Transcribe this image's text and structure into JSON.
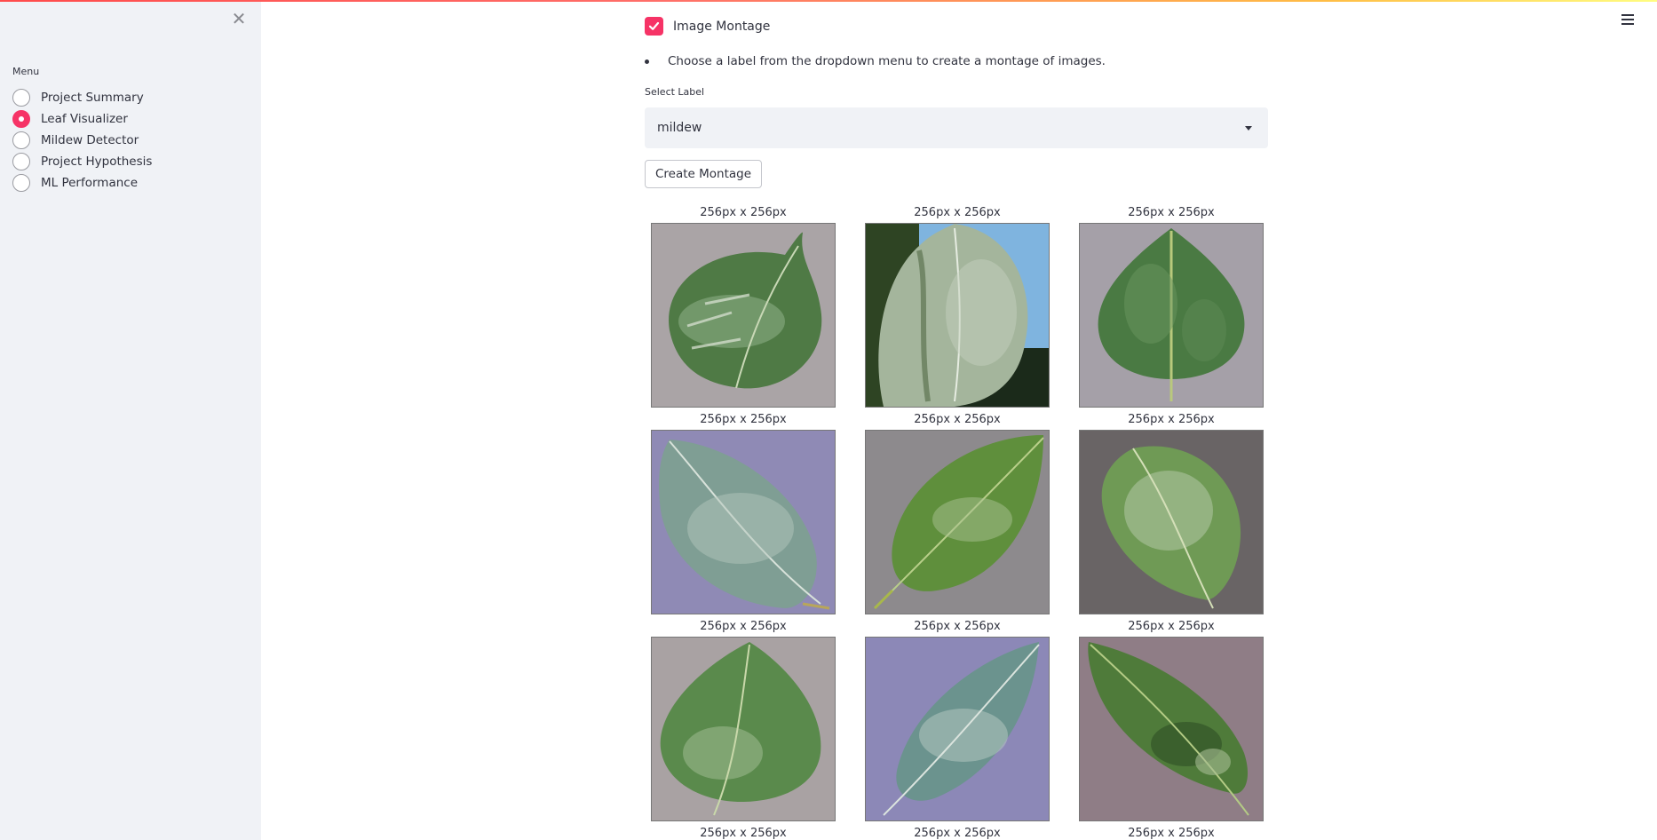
{
  "sidebar": {
    "close_icon": "close-icon",
    "menu_label": "Menu",
    "items": [
      {
        "label": "Project Summary",
        "selected": false
      },
      {
        "label": "Leaf Visualizer",
        "selected": true
      },
      {
        "label": "Mildew Detector",
        "selected": false
      },
      {
        "label": "Project Hypothesis",
        "selected": false
      },
      {
        "label": "ML Performance",
        "selected": false
      }
    ]
  },
  "main": {
    "checkbox_label": "Image Montage",
    "checkbox_checked": true,
    "instruction": "Choose a label from the dropdown menu to create a montage of images.",
    "select_label": "Select Label",
    "select_value": "mildew",
    "button_label": "Create Montage",
    "captions": [
      "256px x 256px",
      "256px x 256px",
      "256px x 256px",
      "256px x 256px",
      "256px x 256px",
      "256px x 256px",
      "256px x 256px",
      "256px x 256px",
      "256px x 256px",
      "256px x 256px",
      "256px x 256px",
      "256px x 256px"
    ]
  },
  "colors": {
    "accent": "#f63366",
    "sidebar_bg": "#f0f2f6",
    "text": "#31333f"
  },
  "icons": {
    "menu": "hamburger-menu-icon",
    "dropdown": "chevron-down-icon",
    "check": "check-icon"
  }
}
